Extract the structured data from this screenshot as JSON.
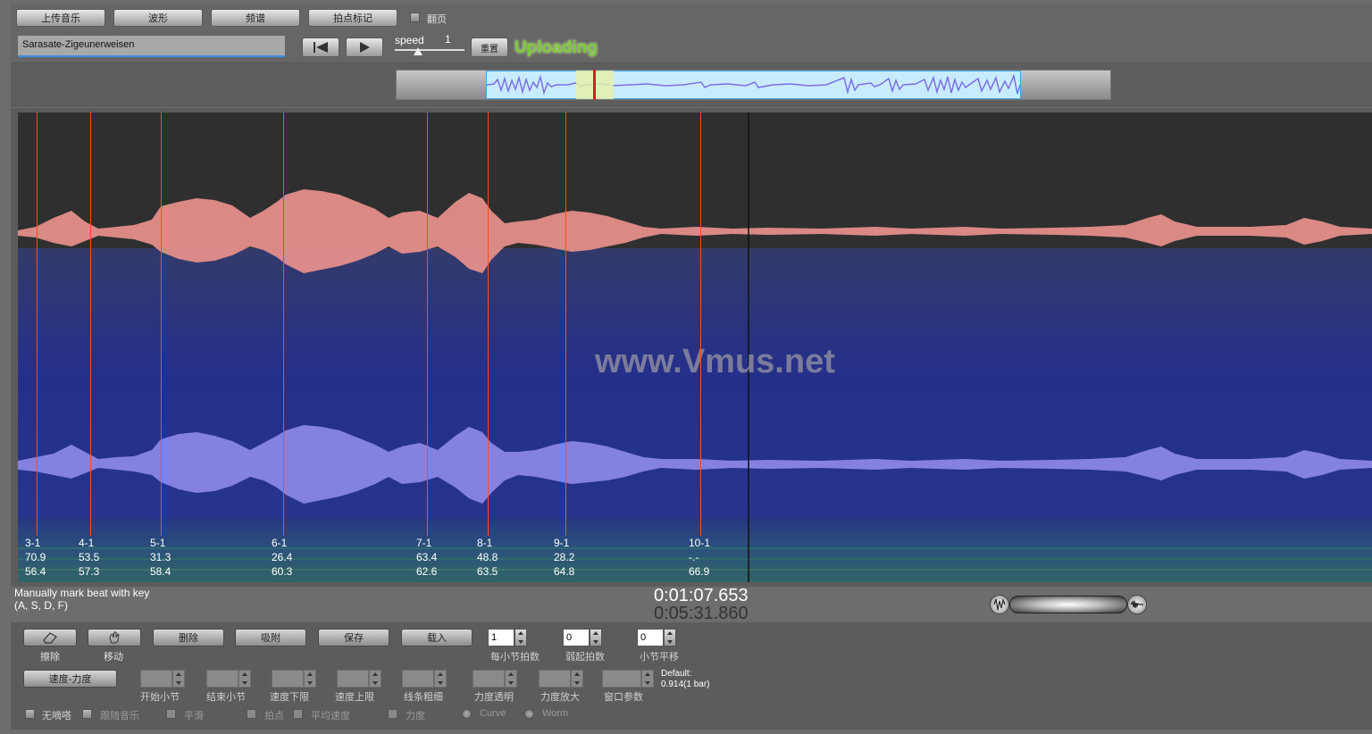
{
  "toolbar": {
    "upload": "上传音乐",
    "waveform": "波形",
    "spectrum": "频谱",
    "beat_mark": "拍点标记",
    "page_turn": "翻页"
  },
  "track": {
    "title": "Sarasate-Zigeunerweisen",
    "speed_label": "speed",
    "speed_value": "1",
    "reset": "重置",
    "status": "Uploading"
  },
  "watermark": "www.Vmus.net",
  "beats": [
    {
      "bar": "3-1",
      "v1": "70.9",
      "v2": "56.4"
    },
    {
      "bar": "4-1",
      "v1": "53.5",
      "v2": "57.3"
    },
    {
      "bar": "5-1",
      "v1": "31.3",
      "v2": "58.4"
    },
    {
      "bar": "6-1",
      "v1": "26.4",
      "v2": "60.3"
    },
    {
      "bar": "7-1",
      "v1": "63.4",
      "v2": "62.6"
    },
    {
      "bar": "8-1",
      "v1": "48.8",
      "v2": "63.5"
    },
    {
      "bar": "9-1",
      "v1": "28.2",
      "v2": "64.8"
    },
    {
      "bar": "10-1",
      "v1": "-.-",
      "v2": "66.9"
    }
  ],
  "hint": {
    "line1": "Manually mark beat with key",
    "line2": "(A, S, D, F)"
  },
  "time": {
    "current": "0:01:07.653",
    "total": "0:05:31.860"
  },
  "edit": {
    "erase_label": "擦除",
    "move_label": "移动",
    "delete": "删除",
    "snap": "吸附",
    "save": "保存",
    "load": "载入",
    "beats_per_bar_value": "1",
    "beats_per_bar_label": "每小节拍数",
    "pickup_value": "0",
    "pickup_label": "弱起拍数",
    "bar_shift_value": "0",
    "bar_shift_label": "小节平移",
    "tempo_dynamics": "速度-力度",
    "start_bar": "开始小节",
    "end_bar": "结束小节",
    "tempo_min": "速度下限",
    "tempo_max": "速度上限",
    "line_width": "线条粗细",
    "dyn_transparent": "力度透明",
    "dyn_zoom": "力度放大",
    "window_param": "窗口参数",
    "default_label": "Default:",
    "default_value": "0.914(1 bar)"
  },
  "options": {
    "no_tick": "无嘀嗒",
    "follow_music": "跟随音乐",
    "smooth": "平滑",
    "beat_point": "拍点",
    "avg_tempo": "平均速度",
    "dynamics": "力度",
    "curve": "Curve",
    "worm": "Worm"
  }
}
